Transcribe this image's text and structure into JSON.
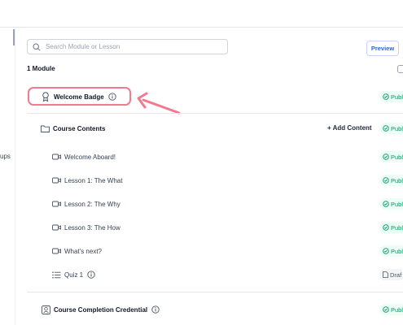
{
  "search": {
    "placeholder": "Search Module or Lesson"
  },
  "toolbar": {
    "preview_label": "Preview"
  },
  "left_panel": {
    "label": "ups"
  },
  "module_count": "1 Module",
  "badge": {
    "label": "Welcome Badge",
    "status": "Publi"
  },
  "course_contents": {
    "label": "Course Contents",
    "add_label": "+ Add Content",
    "status": "Publi"
  },
  "lessons": [
    {
      "label": "Welcome Aboard!",
      "status": "Publi",
      "type": "video"
    },
    {
      "label": "Lesson 1: The What",
      "status": "Publi",
      "type": "video"
    },
    {
      "label": "Lesson 2: The Why",
      "status": "Publi",
      "type": "video"
    },
    {
      "label": "Lesson 3: The How",
      "status": "Publi",
      "type": "video"
    },
    {
      "label": "What's next?",
      "status": "Publi",
      "type": "video"
    },
    {
      "label": "Quiz 1",
      "status": "Draf",
      "type": "quiz"
    }
  ],
  "credential": {
    "label": "Course Completion Credential",
    "status": "Publi"
  },
  "colors": {
    "accent": "#2563eb",
    "published": "#059669",
    "highlight": "#f07a8e"
  }
}
